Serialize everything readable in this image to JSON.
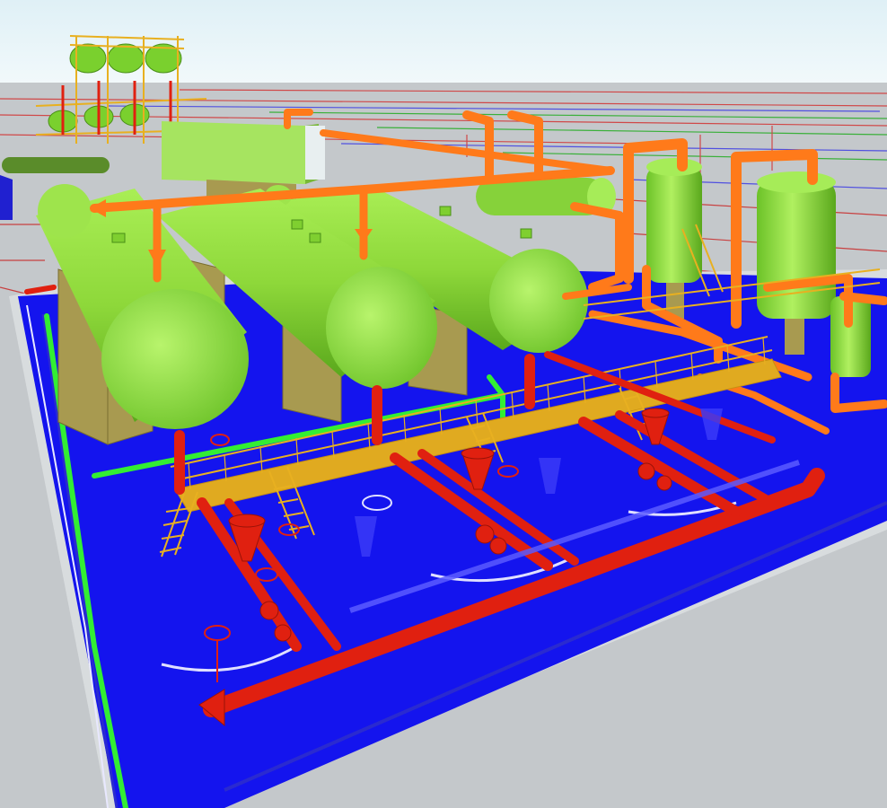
{
  "colors": {
    "sky": "#e6f3f8",
    "ground": "#c9cdd0",
    "slab": "#1010f0",
    "slab_edge": "#2a2ad8",
    "vessel": "#8fe03a",
    "vessel_shade": "#5fb020",
    "vessel_light": "#b6f26a",
    "pipe_orange": "#ff7a1a",
    "pipe_red": "#e02010",
    "pipe_green": "#33ee33",
    "walkway": "#e8b020",
    "foundation": "#a89a50",
    "blueprint": "#d04040"
  }
}
